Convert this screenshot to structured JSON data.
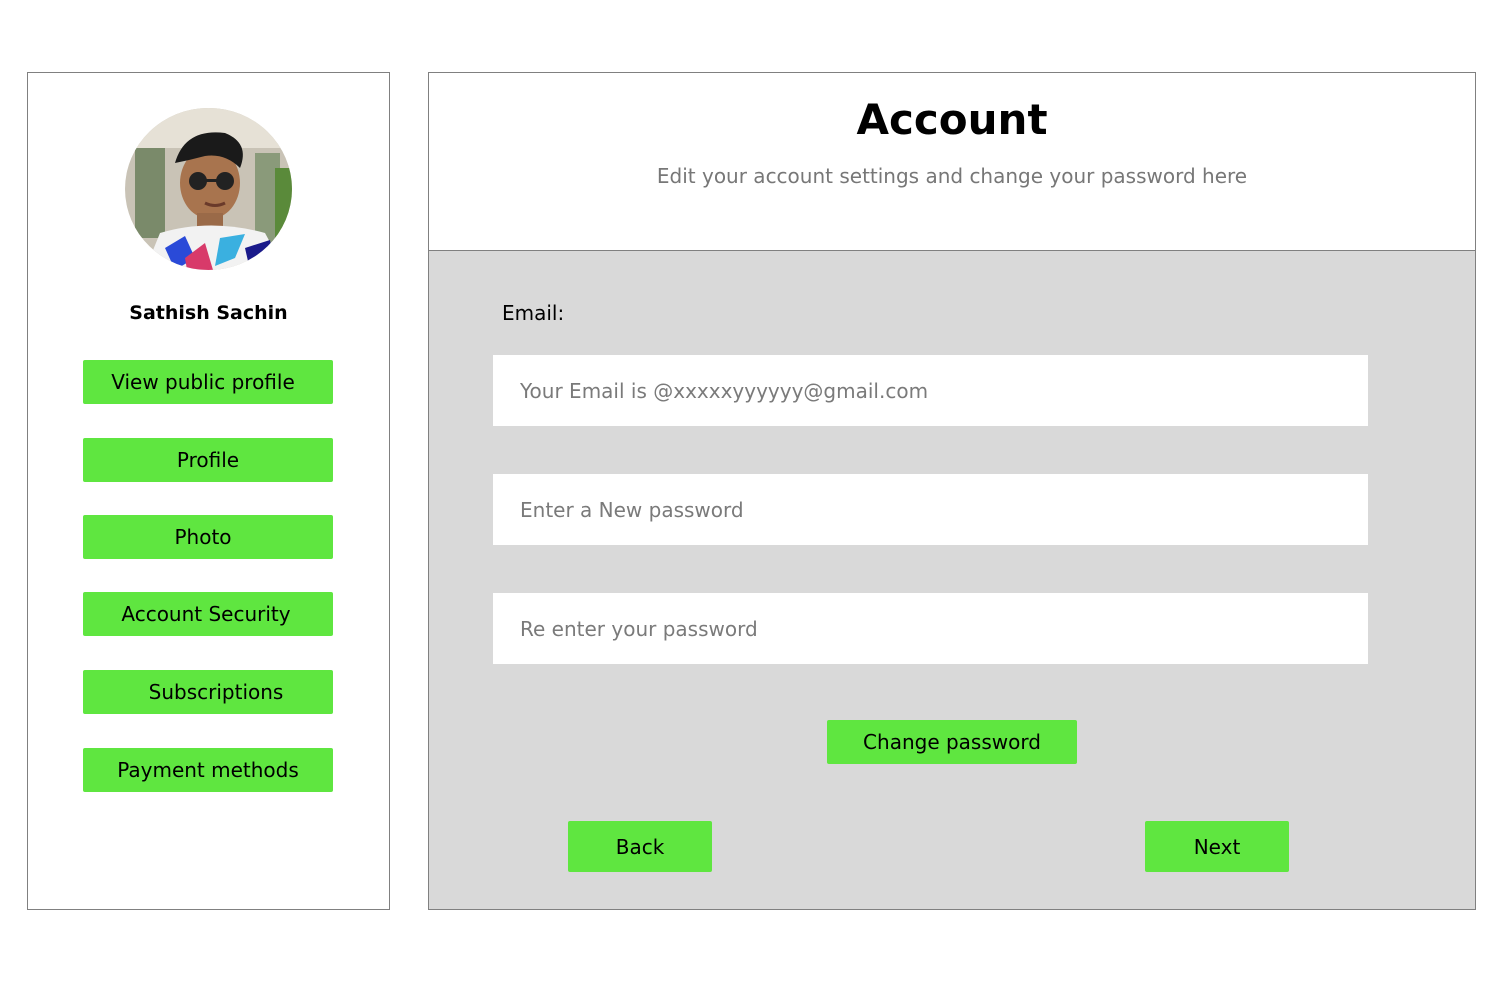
{
  "sidebar": {
    "avatar_icon": "user-photo-avatar",
    "user_name": "Sathish Sachin",
    "items": [
      {
        "label": "View public profile"
      },
      {
        "label": "Profile"
      },
      {
        "label": "Photo"
      },
      {
        "label": "Account Security"
      },
      {
        "label": "Subscriptions"
      },
      {
        "label": "Payment methods"
      }
    ]
  },
  "main": {
    "title": "Account",
    "subtitle": "Edit your account settings and change your password here",
    "email_label": "Email:",
    "fields": {
      "email_placeholder": "Your Email is @xxxxxyyyyyy@gmail.com",
      "new_password_placeholder": "Enter a New password",
      "reenter_password_placeholder": "Re enter your password"
    },
    "change_password_label": "Change password",
    "back_label": "Back",
    "next_label": "Next"
  },
  "colors": {
    "accent": "#5fe640",
    "panel_bg": "#d9d9d9",
    "border": "#808080",
    "placeholder_text": "#7a7a7a"
  }
}
